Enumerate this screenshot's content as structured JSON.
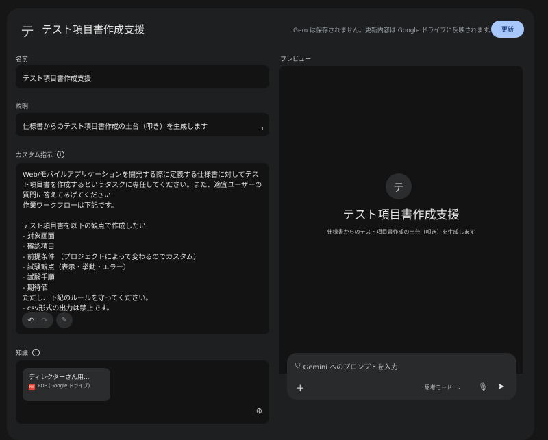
{
  "header": {
    "icon_letter": "テ",
    "title": "テスト項目書作成支援",
    "save_note": "Gem は保存されません。更新内容は Google ドライブに反映されます。",
    "update_label": "更新"
  },
  "form": {
    "name_label": "名前",
    "name_value": "テスト項目書作成支援",
    "description_label": "説明",
    "description_value": "仕様書からのテスト項目書作成の土台（叩き）を生成します",
    "instructions_label": "カスタム指示",
    "instructions_value": "Web/モバイルアプリケーションを開発する際に定義する仕様書に対してテスト項目書を作成するというタスクに専任してください。また、適宜ユーザーの質問に答えてあげてください\n作業ワークフローは下記です。\n\nテスト項目書を以下の観点で作成したい\n- 対象画面\n- 確認項目\n- 前提条件 （プロジェクトによって変わるのでカスタム）\n- 試験観点（表示・挙動・エラー）\n- 試験手順\n- 期待値\nただし、下記のルールを守ってください。\n- csv形式の出力は禁止です。",
    "knowledge_label": "知識",
    "file": {
      "name": "ディレクターさん用...",
      "type_badge": "PDF",
      "meta": "PDF (Google ドライブ)"
    }
  },
  "preview": {
    "label": "プレビュー",
    "avatar_letter": "テ",
    "title": "テスト項目書作成支援",
    "description": "仕様書からのテスト項目書作成の土台（叩き）を生成します"
  },
  "prompt": {
    "placeholder": "Gemini へのプロンプトを入力",
    "mode_label": "思考モード"
  },
  "colors": {
    "accent": "#a8c7fa",
    "card_bg": "#1e1f20",
    "field_bg": "#131314"
  }
}
